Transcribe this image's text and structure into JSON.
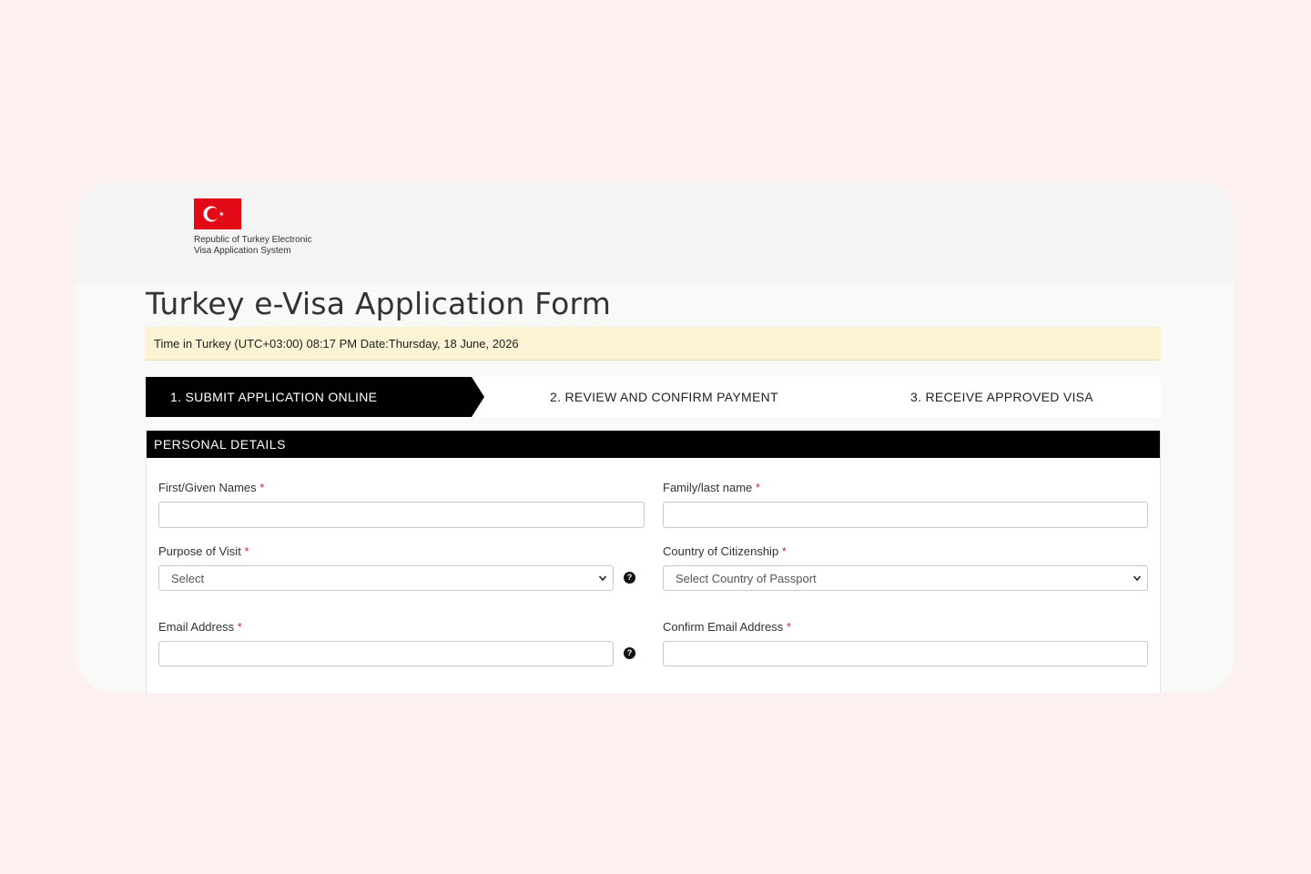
{
  "header": {
    "logo_line1": "Republic of Turkey Electronic",
    "logo_line2": "Visa Application System",
    "flag_color": "#e30a17"
  },
  "page_title": "Turkey e-Visa Application Form",
  "time_bar": "Time in Turkey (UTC+03:00) 08:17 PM Date:Thursday, 18 June, 2026",
  "steps": [
    {
      "label": "1. SUBMIT APPLICATION ONLINE",
      "active": true
    },
    {
      "label": "2. REVIEW AND CONFIRM PAYMENT",
      "active": false
    },
    {
      "label": "3. RECEIVE APPROVED VISA",
      "active": false
    }
  ],
  "section": {
    "title": "PERSONAL DETAILS",
    "fields": {
      "first_name": {
        "label": "First/Given Names",
        "value": ""
      },
      "last_name": {
        "label": "Family/last name",
        "value": ""
      },
      "purpose": {
        "label": "Purpose of Visit",
        "selected": "Select"
      },
      "citizenship": {
        "label": "Country of Citizenship",
        "selected": "Select Country of Passport"
      },
      "email": {
        "label": "Email Address",
        "value": ""
      },
      "confirm_email": {
        "label": "Confirm Email Address",
        "value": ""
      }
    },
    "required_mark": "*",
    "help_glyph": "?"
  },
  "icons": {
    "help": "question-circle-icon",
    "dropdown": "chevron-down-icon",
    "flag": "turkey-flag-icon"
  }
}
